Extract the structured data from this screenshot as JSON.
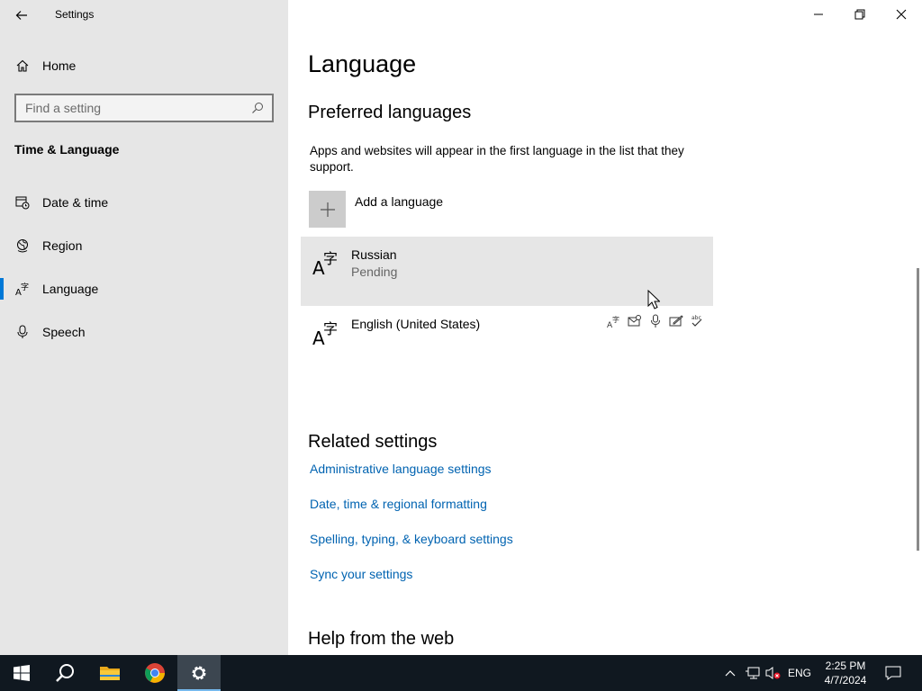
{
  "window": {
    "title": "Settings"
  },
  "sidebar": {
    "home_label": "Home",
    "search_placeholder": "Find a setting",
    "section_title": "Time & Language",
    "items": [
      {
        "label": "Date & time",
        "icon": "calendar-clock-icon"
      },
      {
        "label": "Region",
        "icon": "globe-icon"
      },
      {
        "label": "Language",
        "icon": "language-icon",
        "active": true
      },
      {
        "label": "Speech",
        "icon": "microphone-icon"
      }
    ]
  },
  "main": {
    "title": "Language",
    "preferred_heading": "Preferred languages",
    "preferred_desc": "Apps and websites will appear in the first language in the list that they support.",
    "add_language_label": "Add a language",
    "languages": [
      {
        "name": "Russian",
        "status": "Pending",
        "selected": true
      },
      {
        "name": "English (United States)",
        "status": "",
        "features": [
          "language-pack-icon",
          "display-language-icon",
          "speech-icon",
          "handwriting-icon",
          "spellcheck-icon"
        ]
      }
    ],
    "related_heading": "Related settings",
    "related_links": [
      "Administrative language settings",
      "Date, time & regional formatting",
      "Spelling, typing, & keyboard settings",
      "Sync your settings"
    ],
    "help_heading": "Help from the web"
  },
  "taskbar": {
    "lang_indicator": "ENG",
    "time": "2:25 PM",
    "date": "4/7/2024"
  },
  "colors": {
    "accent": "#0078d7",
    "link": "#0063b1",
    "sidebar_bg": "#e6e6e6",
    "taskbar_bg": "#101820"
  }
}
